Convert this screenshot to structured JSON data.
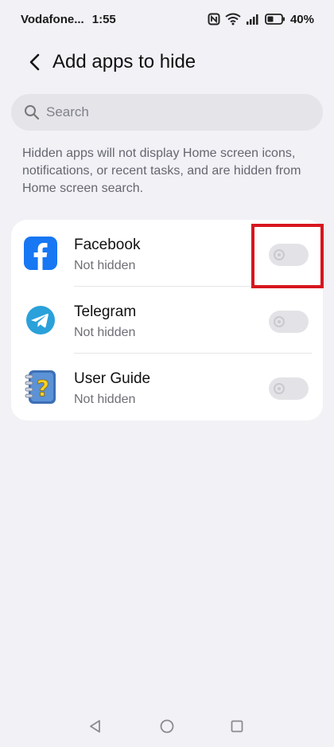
{
  "status_bar": {
    "carrier": "Vodafone...",
    "time": "1:55",
    "battery": "40%"
  },
  "header": {
    "title": "Add apps to hide"
  },
  "search": {
    "placeholder": "Search",
    "value": ""
  },
  "description": "Hidden apps will not display Home screen icons, notifications, or recent tasks, and are hidden from Home screen search.",
  "apps": [
    {
      "name": "Facebook",
      "status": "Not hidden",
      "icon": "facebook-icon",
      "hidden": false
    },
    {
      "name": "Telegram",
      "status": "Not hidden",
      "icon": "telegram-icon",
      "hidden": false
    },
    {
      "name": "User Guide",
      "status": "Not hidden",
      "icon": "user-guide-icon",
      "hidden": false
    }
  ],
  "colors": {
    "background": "#f1f1f6",
    "card": "#ffffff",
    "facebook_blue": "#1877f2",
    "telegram_blue": "#2aa1da",
    "highlight_red": "#d7161e"
  }
}
